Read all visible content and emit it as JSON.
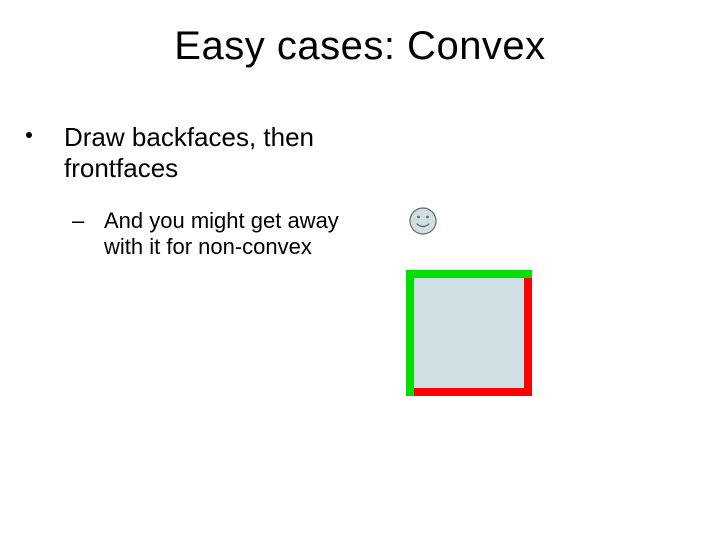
{
  "slide": {
    "title": "Easy cases: Convex",
    "bullet1": "Draw backfaces, then frontfaces",
    "sub1": "And you might get away with it for non-convex"
  },
  "icons": {
    "smiley": "smiley-face"
  },
  "colors": {
    "box_back_red": "#ff0000",
    "box_front_green": "#00e000",
    "box_fill": "#cfe0e4",
    "smiley_fill": "#cfe0e4",
    "smiley_stroke": "#5a5a5a"
  }
}
